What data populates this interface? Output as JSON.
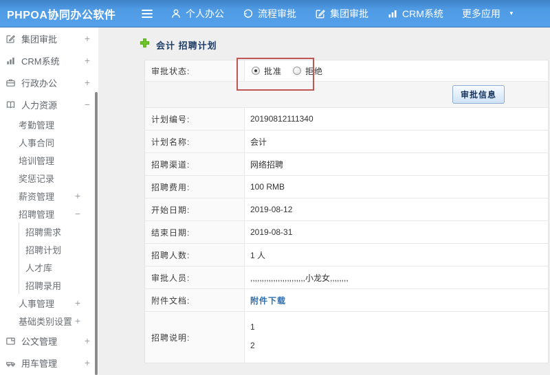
{
  "header": {
    "logo": "PHPOA协同办公软件",
    "nav": [
      {
        "label": "个人办公",
        "icon": "user-icon"
      },
      {
        "label": "流程审批",
        "icon": "history-icon"
      },
      {
        "label": "集团审批",
        "icon": "edit-icon"
      },
      {
        "label": "CRM系统",
        "icon": "bar-chart-icon"
      },
      {
        "label": "更多应用",
        "icon": "caret-down-icon"
      }
    ]
  },
  "sidebar": {
    "items": [
      {
        "label": "集团审批",
        "toggle": "+",
        "icon": "edit-icon"
      },
      {
        "label": "CRM系统",
        "toggle": "+",
        "icon": "bar-chart-icon"
      },
      {
        "label": "行政办公",
        "toggle": "+",
        "icon": "briefcase-icon"
      },
      {
        "label": "人力资源",
        "toggle": "−",
        "icon": "book-icon"
      },
      {
        "label": "考勤管理",
        "toggle": ""
      },
      {
        "label": "人事合同",
        "toggle": ""
      },
      {
        "label": "培训管理",
        "toggle": ""
      },
      {
        "label": "奖惩记录",
        "toggle": ""
      },
      {
        "label": "薪资管理",
        "toggle": "+"
      },
      {
        "label": "招聘管理",
        "toggle": "−"
      },
      {
        "label": "招聘需求",
        "toggle": ""
      },
      {
        "label": "招聘计划",
        "toggle": ""
      },
      {
        "label": "人才库",
        "toggle": ""
      },
      {
        "label": "招聘录用",
        "toggle": ""
      },
      {
        "label": "人事管理",
        "toggle": "+"
      },
      {
        "label": "基础类别设置",
        "toggle": "+"
      },
      {
        "label": "公文管理",
        "toggle": "+",
        "icon": "document-icon"
      },
      {
        "label": "用车管理",
        "toggle": "+",
        "icon": "car-icon"
      }
    ]
  },
  "main": {
    "title": "会计 招聘计划",
    "form": {
      "status": {
        "label": "审批状态:",
        "options": [
          {
            "label": "批准",
            "selected": true
          },
          {
            "label": "拒绝",
            "selected": false
          }
        ]
      },
      "approve_button": "审批信息",
      "rows": [
        {
          "label": "计划编号:",
          "value": "20190812111340"
        },
        {
          "label": "计划名称:",
          "value": "会计"
        },
        {
          "label": "招聘渠道:",
          "value": "网络招聘"
        },
        {
          "label": "招聘费用:",
          "value": "100 RMB"
        },
        {
          "label": "开始日期:",
          "value": "2019-08-12"
        },
        {
          "label": "结束日期:",
          "value": "2019-08-31"
        },
        {
          "label": "招聘人数:",
          "value": "1 人"
        },
        {
          "label": "审批人员:",
          "value": ",,,,,,,,,,,,,,,,,,,,,,,,小龙女,,,,,,,,"
        },
        {
          "label": "附件文档:",
          "value": "附件下载"
        },
        {
          "label": "招聘说明:",
          "value": "1\n2"
        }
      ]
    }
  },
  "colors": {
    "header_blue": "#4f9be4",
    "highlight_red": "#c05555",
    "link_blue": "#2f6fb0",
    "title_navy": "#1e3c64",
    "plus_green": "#6fc52c"
  }
}
